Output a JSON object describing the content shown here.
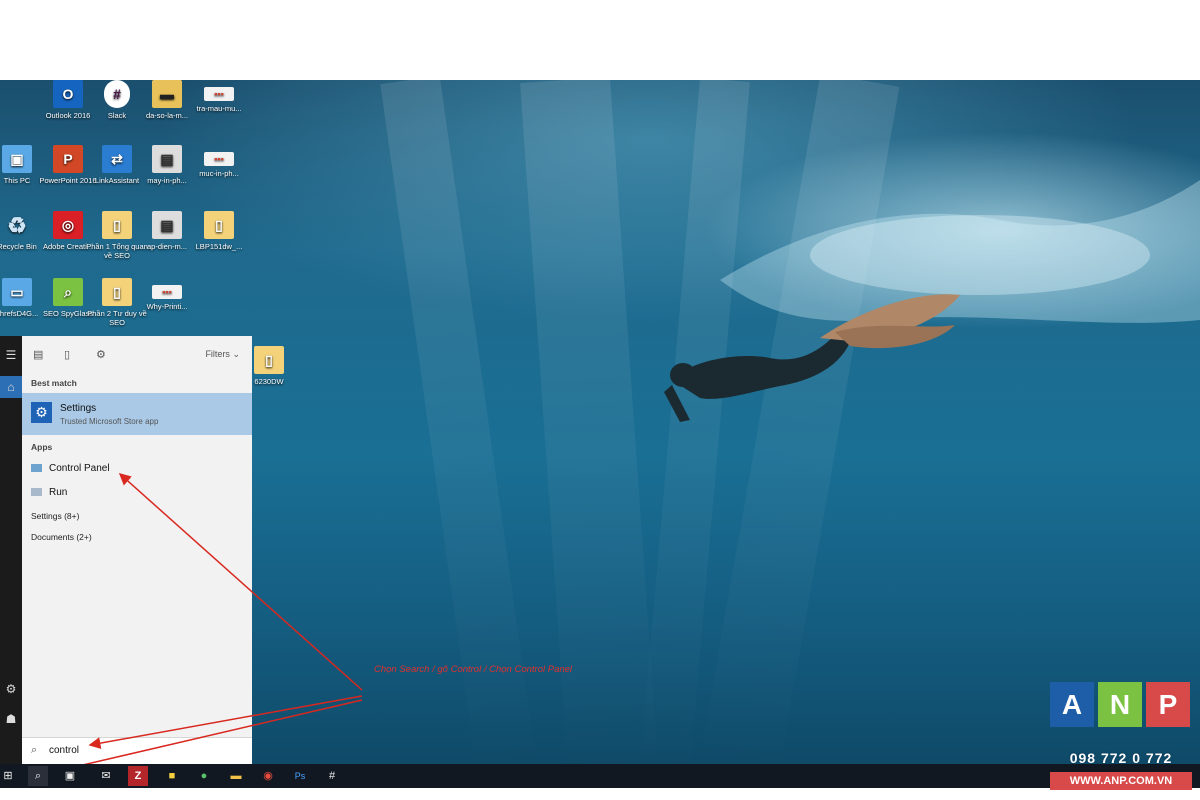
{
  "desktop_icons": [
    {
      "label": "Outlook 2016",
      "symbol": "O",
      "color": "#1565c0"
    },
    {
      "label": "Slack",
      "symbol": "#",
      "color": "#ffffff"
    },
    {
      "label": "da-so-la-m...",
      "symbol": "▬",
      "color": "#5b4a30"
    },
    {
      "label": "tra-mau-mu...",
      "symbol": "▪▪▪",
      "color": "#f2f2f2"
    },
    {
      "label": "This PC",
      "symbol": "▣",
      "color": "#5aa9e6"
    },
    {
      "label": "PowerPoint 2016",
      "symbol": "P",
      "color": "#d24726"
    },
    {
      "label": "LinkAssistant",
      "symbol": "⇄",
      "color": "#2a7dd1"
    },
    {
      "label": "may-in-ph...",
      "symbol": "▤",
      "color": "#dddddd"
    },
    {
      "label": "muc-in-ph...",
      "symbol": "▪▪▪",
      "color": "#f2f2f2"
    },
    {
      "label": "Recycle Bin",
      "symbol": "♻",
      "color": "#9ec6e8"
    },
    {
      "label": "Adobe Creati...",
      "symbol": "◎",
      "color": "#da1f26"
    },
    {
      "label": "Phần 1 Tổng quan về SEO",
      "symbol": "▯",
      "color": "#f3d27a"
    },
    {
      "label": "ap-dien-m...",
      "symbol": "▤",
      "color": "#dddddd"
    },
    {
      "label": "LBP151dw_...",
      "symbol": "▯",
      "color": "#f3d27a"
    },
    {
      "label": "ahrefsD4G...",
      "symbol": "▭",
      "color": "#5aa9e6"
    },
    {
      "label": "SEO SpyGlass",
      "symbol": "⌕",
      "color": "#7cc242"
    },
    {
      "label": "Phần 2 Tư duy về SEO",
      "symbol": "▯",
      "color": "#f3d27a"
    },
    {
      "label": "Why-Printi...",
      "symbol": "▪▪▪",
      "color": "#f2f2f2"
    },
    {
      "label": "6230DW",
      "symbol": "▯",
      "color": "#f3d27a"
    }
  ],
  "search_panel": {
    "filters_label": "Filters",
    "best_match_label": "Best match",
    "best_match": {
      "title": "Settings",
      "subtitle": "Trusted Microsoft Store app"
    },
    "apps_label": "Apps",
    "apps": [
      {
        "label": "Control Panel"
      },
      {
        "label": "Run"
      }
    ],
    "settings_count_label": "Settings (8+)",
    "documents_count_label": "Documents (2+)",
    "search_value": "control"
  },
  "annotation": "Chọn Search / gõ Control / Chọn Control Panel",
  "logo": {
    "letters": [
      "A",
      "N",
      "P"
    ],
    "colors": [
      "#1e5ea8",
      "#7cc242",
      "#d84a4a"
    ],
    "phone": "098 772 0 772",
    "website": "WWW.ANP.COM.VN"
  },
  "colors": {
    "accent": "#1e63b6",
    "annotation": "#e0302e"
  }
}
